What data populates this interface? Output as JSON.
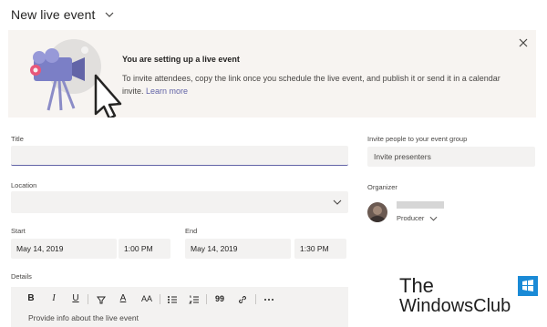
{
  "header": {
    "title": "New live event"
  },
  "banner": {
    "title": "You are setting up a live event",
    "text": "To invite attendees, copy the link once you schedule the live event, and publish it or send it in a calendar invite.",
    "link": "Learn more"
  },
  "form": {
    "title_label": "Title",
    "title_value": "",
    "location_label": "Location",
    "location_value": "",
    "start_label": "Start",
    "start_date": "May 14, 2019",
    "start_time": "1:00 PM",
    "end_label": "End",
    "end_date": "May 14, 2019",
    "end_time": "1:30 PM",
    "details_label": "Details",
    "details_placeholder": "Provide info about the live event"
  },
  "invite": {
    "label": "Invite people to your event group",
    "placeholder": "Invite presenters",
    "organizer_label": "Organizer",
    "organizer_role": "Producer"
  },
  "toolbar": {
    "bold": "B",
    "italic": "I",
    "underline": "U",
    "font_color": "A",
    "font_size": "AA",
    "quote": "99"
  },
  "watermark": {
    "line1": "The",
    "line2": "WindowsClub"
  },
  "colors": {
    "accent": "#6264a7",
    "banner_bg": "#f7f4f1",
    "field_bg": "#f3f2f1"
  },
  "icons": [
    "chevron-down-icon",
    "close-icon",
    "camera-illustration",
    "bold-icon",
    "italic-icon",
    "underline-icon",
    "highlight-icon",
    "font-color-icon",
    "font-size-icon",
    "bullet-list-icon",
    "numbered-list-icon",
    "quote-icon",
    "link-icon",
    "more-icon"
  ]
}
